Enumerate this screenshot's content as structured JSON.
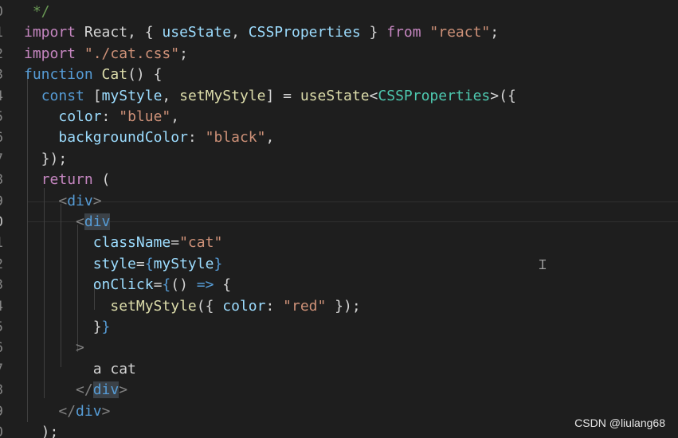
{
  "editor": {
    "line_numbers": [
      "0",
      "1",
      "2",
      "3",
      "4",
      "5",
      "6",
      "7",
      "8",
      "9",
      "0",
      "1",
      "2",
      "3",
      "4",
      "5",
      "6",
      "7",
      "8",
      "9",
      "0"
    ],
    "lines": [
      [
        {
          "t": " */",
          "c": "cm"
        }
      ],
      [
        {
          "t": "import",
          "c": "kw"
        },
        {
          "t": " React, { ",
          "c": "pu"
        },
        {
          "t": "useState",
          "c": "vr"
        },
        {
          "t": ", ",
          "c": "pu"
        },
        {
          "t": "CSSProperties",
          "c": "vr"
        },
        {
          "t": " } ",
          "c": "pu"
        },
        {
          "t": "from",
          "c": "kw"
        },
        {
          "t": " ",
          "c": "pu"
        },
        {
          "t": "\"react\"",
          "c": "st"
        },
        {
          "t": ";",
          "c": "pu"
        }
      ],
      [
        {
          "t": "import",
          "c": "kw"
        },
        {
          "t": " ",
          "c": "pu"
        },
        {
          "t": "\"./cat.css\"",
          "c": "st"
        },
        {
          "t": ";",
          "c": "pu"
        }
      ],
      [
        {
          "t": "function",
          "c": "sk"
        },
        {
          "t": " ",
          "c": "pu"
        },
        {
          "t": "Cat",
          "c": "fn"
        },
        {
          "t": "() {",
          "c": "pu"
        }
      ],
      [
        {
          "t": "  ",
          "c": "pu"
        },
        {
          "t": "const",
          "c": "sk"
        },
        {
          "t": " [",
          "c": "pu"
        },
        {
          "t": "myStyle",
          "c": "vr"
        },
        {
          "t": ", ",
          "c": "pu"
        },
        {
          "t": "setMyStyle",
          "c": "fn"
        },
        {
          "t": "] = ",
          "c": "pu"
        },
        {
          "t": "useState",
          "c": "fn"
        },
        {
          "t": "<",
          "c": "pu"
        },
        {
          "t": "CSSProperties",
          "c": "ty"
        },
        {
          "t": ">({",
          "c": "pu"
        }
      ],
      [
        {
          "t": "    ",
          "c": "pu"
        },
        {
          "t": "color",
          "c": "vr"
        },
        {
          "t": ": ",
          "c": "pu"
        },
        {
          "t": "\"blue\"",
          "c": "st"
        },
        {
          "t": ",",
          "c": "pu"
        }
      ],
      [
        {
          "t": "    ",
          "c": "pu"
        },
        {
          "t": "backgroundColor",
          "c": "vr"
        },
        {
          "t": ": ",
          "c": "pu"
        },
        {
          "t": "\"black\"",
          "c": "st"
        },
        {
          "t": ",",
          "c": "pu"
        }
      ],
      [
        {
          "t": "  });",
          "c": "pu"
        }
      ],
      [
        {
          "t": "  ",
          "c": "pu"
        },
        {
          "t": "return",
          "c": "kw"
        },
        {
          "t": " (",
          "c": "pu"
        }
      ],
      [
        {
          "t": "    ",
          "c": "pu"
        },
        {
          "t": "<",
          "c": "tg"
        },
        {
          "t": "div",
          "c": "sk"
        },
        {
          "t": ">",
          "c": "tg"
        }
      ],
      [
        {
          "t": "      ",
          "c": "pu"
        },
        {
          "t": "<",
          "c": "tg"
        },
        {
          "t": "div",
          "c": "sk",
          "h": true
        }
      ],
      [
        {
          "t": "        ",
          "c": "pu"
        },
        {
          "t": "className",
          "c": "vr"
        },
        {
          "t": "=",
          "c": "pu"
        },
        {
          "t": "\"cat\"",
          "c": "st"
        }
      ],
      [
        {
          "t": "        ",
          "c": "pu"
        },
        {
          "t": "style",
          "c": "vr"
        },
        {
          "t": "=",
          "c": "pu"
        },
        {
          "t": "{",
          "c": "sk"
        },
        {
          "t": "myStyle",
          "c": "vr"
        },
        {
          "t": "}",
          "c": "sk"
        }
      ],
      [
        {
          "t": "        ",
          "c": "pu"
        },
        {
          "t": "onClick",
          "c": "vr"
        },
        {
          "t": "=",
          "c": "pu"
        },
        {
          "t": "{",
          "c": "sk"
        },
        {
          "t": "() ",
          "c": "pu"
        },
        {
          "t": "=>",
          "c": "sk"
        },
        {
          "t": " {",
          "c": "pu"
        }
      ],
      [
        {
          "t": "          ",
          "c": "pu"
        },
        {
          "t": "setMyStyle",
          "c": "fn"
        },
        {
          "t": "({ ",
          "c": "pu"
        },
        {
          "t": "color",
          "c": "vr"
        },
        {
          "t": ": ",
          "c": "pu"
        },
        {
          "t": "\"red\"",
          "c": "st"
        },
        {
          "t": " });",
          "c": "pu"
        }
      ],
      [
        {
          "t": "        ",
          "c": "pu"
        },
        {
          "t": "}",
          "c": "pu"
        },
        {
          "t": "}",
          "c": "sk"
        }
      ],
      [
        {
          "t": "      ",
          "c": "pu"
        },
        {
          "t": ">",
          "c": "tg"
        }
      ],
      [
        {
          "t": "        ",
          "c": "pu"
        },
        {
          "t": "a cat",
          "c": "pu"
        }
      ],
      [
        {
          "t": "      ",
          "c": "pu"
        },
        {
          "t": "</",
          "c": "tg"
        },
        {
          "t": "div",
          "c": "sk",
          "h": true
        },
        {
          "t": ">",
          "c": "tg"
        }
      ],
      [
        {
          "t": "    ",
          "c": "pu"
        },
        {
          "t": "</",
          "c": "tg"
        },
        {
          "t": "div",
          "c": "sk"
        },
        {
          "t": ">",
          "c": "tg"
        }
      ],
      [
        {
          "t": "  );",
          "c": "pu"
        }
      ]
    ]
  },
  "watermark": {
    "text": "CSDN @liulang68"
  },
  "colors": {
    "background": "#1e1e1e",
    "keyword_control": "#c586c0",
    "keyword_storage": "#569cd6",
    "function": "#dcdcaa",
    "type": "#4ec9b0",
    "variable": "#9cdcfe",
    "string": "#ce9178",
    "comment": "#6a9955"
  },
  "icons": {
    "mouse_cursor": "text-cursor-icon"
  }
}
